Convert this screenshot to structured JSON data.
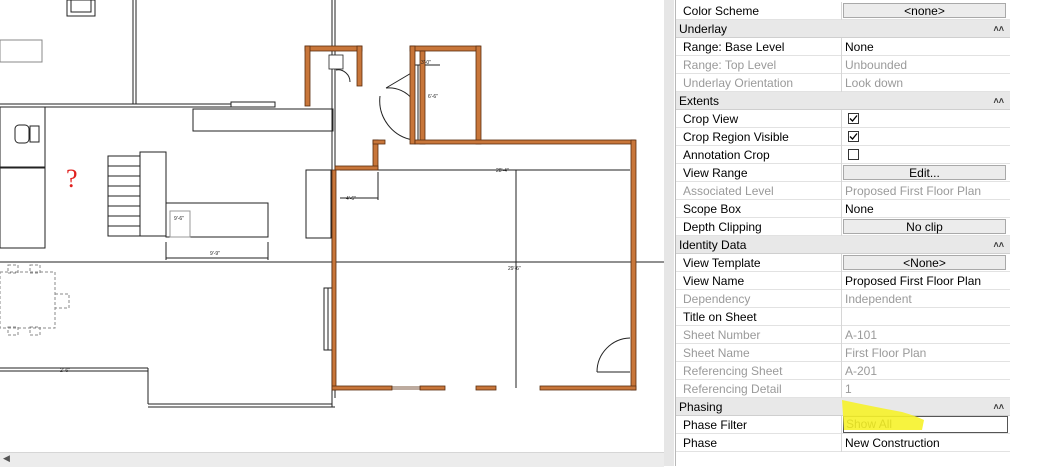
{
  "drawing": {
    "question_mark": "?",
    "dimensions": [
      "9'-9\"",
      "4'-6\"",
      "28'-4\"",
      "3'-0\"",
      "9'-6\"",
      "6'-6\"",
      "29'-6\"",
      "2'-6\""
    ]
  },
  "properties": {
    "rows": [
      {
        "type": "param",
        "label": "Color Scheme",
        "value": "<none>",
        "kind": "button",
        "enabled": true
      },
      {
        "type": "category",
        "label": "Underlay"
      },
      {
        "type": "param",
        "label": "Range: Base Level",
        "value": "None",
        "kind": "text",
        "enabled": true
      },
      {
        "type": "param",
        "label": "Range: Top Level",
        "value": "Unbounded",
        "kind": "text",
        "enabled": false
      },
      {
        "type": "param",
        "label": "Underlay Orientation",
        "value": "Look down",
        "kind": "text",
        "enabled": false
      },
      {
        "type": "category",
        "label": "Extents"
      },
      {
        "type": "param",
        "label": "Crop View",
        "value": "checked",
        "kind": "checkbox",
        "enabled": true
      },
      {
        "type": "param",
        "label": "Crop Region Visible",
        "value": "checked",
        "kind": "checkbox",
        "enabled": true
      },
      {
        "type": "param",
        "label": "Annotation Crop",
        "value": "unchecked",
        "kind": "checkbox",
        "enabled": true
      },
      {
        "type": "param",
        "label": "View Range",
        "value": "Edit...",
        "kind": "button",
        "enabled": true
      },
      {
        "type": "param",
        "label": "Associated Level",
        "value": "Proposed First Floor Plan",
        "kind": "text",
        "enabled": false
      },
      {
        "type": "param",
        "label": "Scope Box",
        "value": "None",
        "kind": "text",
        "enabled": true
      },
      {
        "type": "param",
        "label": "Depth Clipping",
        "value": "No clip",
        "kind": "button",
        "enabled": true
      },
      {
        "type": "category",
        "label": "Identity Data"
      },
      {
        "type": "param",
        "label": "View Template",
        "value": "<None>",
        "kind": "button",
        "enabled": true
      },
      {
        "type": "param",
        "label": "View Name",
        "value": "Proposed First Floor Plan",
        "kind": "text",
        "enabled": true
      },
      {
        "type": "param",
        "label": "Dependency",
        "value": "Independent",
        "kind": "text",
        "enabled": false
      },
      {
        "type": "param",
        "label": "Title on Sheet",
        "value": "",
        "kind": "text",
        "enabled": true
      },
      {
        "type": "param",
        "label": "Sheet Number",
        "value": "A-101",
        "kind": "text",
        "enabled": false
      },
      {
        "type": "param",
        "label": "Sheet Name",
        "value": "First Floor Plan",
        "kind": "text",
        "enabled": false
      },
      {
        "type": "param",
        "label": "Referencing Sheet",
        "value": "A-201",
        "kind": "text",
        "enabled": false
      },
      {
        "type": "param",
        "label": "Referencing Detail",
        "value": "1",
        "kind": "text",
        "enabled": false
      },
      {
        "type": "category",
        "label": "Phasing"
      },
      {
        "type": "param",
        "label": "Phase Filter",
        "value": "Show All",
        "kind": "edit",
        "enabled": true
      },
      {
        "type": "param",
        "label": "Phase",
        "value": "New Construction",
        "kind": "text",
        "enabled": true
      }
    ]
  },
  "colors": {
    "wall_fill": "#c8763a",
    "highlight": "#f6f22a",
    "category_bg": "#e8e8e8",
    "disabled_text": "#9a9a9a",
    "markup_red": "#e0201e"
  }
}
